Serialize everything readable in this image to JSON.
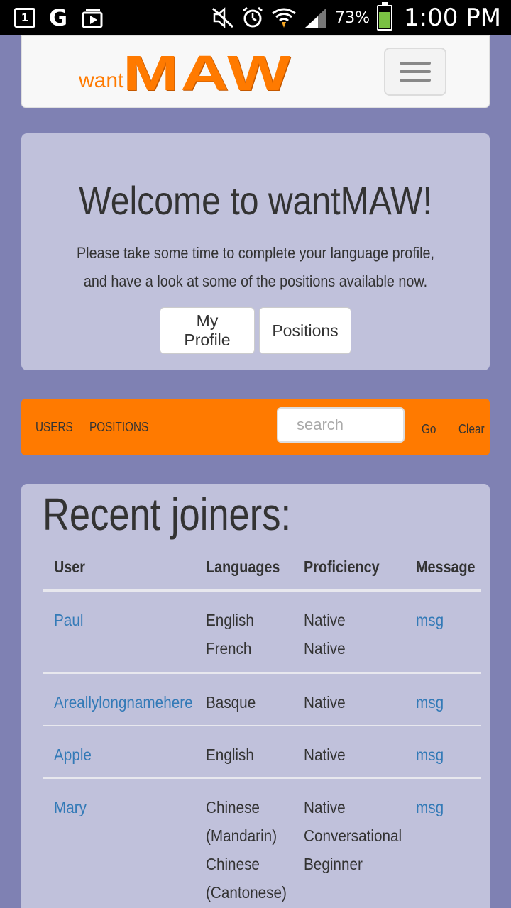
{
  "statusbar": {
    "battery_percent": "73%",
    "time": "1:00 PM",
    "calendar_day": "1",
    "google_glyph": "G",
    "icons": [
      "calendar-icon",
      "google-icon",
      "play-icon",
      "mute-icon",
      "alarm-icon",
      "wifi-icon",
      "signal-icon",
      "battery-icon"
    ]
  },
  "navbar": {
    "logo_want": "want",
    "logo_maw": "MAW"
  },
  "welcome": {
    "title": "Welcome to wantMAW!",
    "text": "Please take some time to complete your language profile, and have a look at some of the positions available now.",
    "profile_button": "My Profile",
    "positions_button": "Positions"
  },
  "nav": {
    "users": "USERS",
    "positions": "POSITIONS",
    "search_placeholder": "search",
    "go": "Go",
    "clear": "Clear"
  },
  "joiners": {
    "title": "Recent joiners:",
    "headers": {
      "user": "User",
      "languages": "Languages",
      "proficiency": "Proficiency",
      "message": "Message"
    },
    "rows": [
      {
        "user": "Paul",
        "languages": [
          "English",
          "French"
        ],
        "proficiency": [
          "Native",
          "Native"
        ],
        "message": "msg"
      },
      {
        "user": "Areallylongnamehere",
        "languages": [
          "Basque"
        ],
        "proficiency": [
          "Native"
        ],
        "message": "msg"
      },
      {
        "user": "Apple",
        "languages": [
          "English"
        ],
        "proficiency": [
          "Native"
        ],
        "message": "msg"
      },
      {
        "user": "Mary",
        "languages": [
          "Chinese",
          "(Mandarin)",
          "Chinese",
          "(Cantonese)"
        ],
        "proficiency": [
          "Native",
          "Conversational",
          "Beginner"
        ],
        "message": "msg"
      }
    ]
  },
  "colors": {
    "background": "#7f81b3",
    "panel": "#c0c1db",
    "accent": "#ff7a00",
    "link": "#337ab7"
  }
}
